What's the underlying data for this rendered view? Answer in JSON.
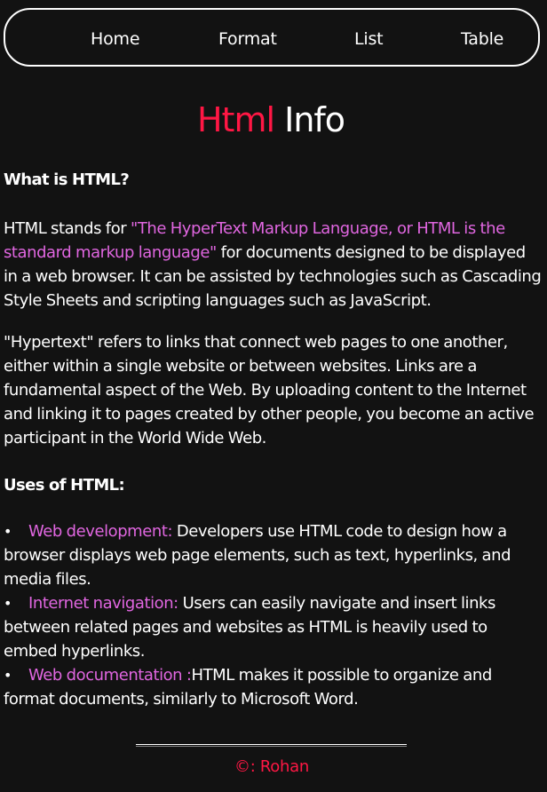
{
  "colors": {
    "background": "#121212",
    "text": "#ffffff",
    "accent_red": "#ff1744",
    "highlight_pink": "#e066e0"
  },
  "nav": {
    "items": [
      {
        "label": "Home"
      },
      {
        "label": "Format"
      },
      {
        "label": "List"
      },
      {
        "label": "Table"
      }
    ]
  },
  "title": {
    "accent": "Html",
    "rest": " Info"
  },
  "sections": {
    "what_heading": "What is HTML?",
    "p1": {
      "before": "HTML stands for ",
      "highlight": "\"The HyperText Markup Language, or HTML is the standard markup language\"",
      "after": " for documents designed to be displayed in a web browser. It can be assisted by technologies such as Cascading Style Sheets and scripting languages such as JavaScript."
    },
    "p2": "\"Hypertext\" refers to links that connect web pages to one another, either within a single website or between websites. Links are a fundamental aspect of the Web. By uploading content to the Internet and linking it to pages created by other people, you become an active participant in the World Wide Web.",
    "uses_heading": "Uses of HTML:",
    "uses": [
      {
        "bullet": "•",
        "term": "Web development:",
        "text": " Developers use HTML code to design how a browser displays web page elements, such as text, hyperlinks, and media files."
      },
      {
        "bullet": "•",
        "term": "Internet navigation:",
        "text": " Users can easily navigate and insert links between related pages and websites as HTML is heavily used to embed hyperlinks."
      },
      {
        "bullet": "•",
        "term": "Web documentation :",
        "text": "HTML makes it possible to organize and format documents, similarly to Microsoft Word."
      }
    ]
  },
  "footer": {
    "text": "©: Rohan"
  }
}
